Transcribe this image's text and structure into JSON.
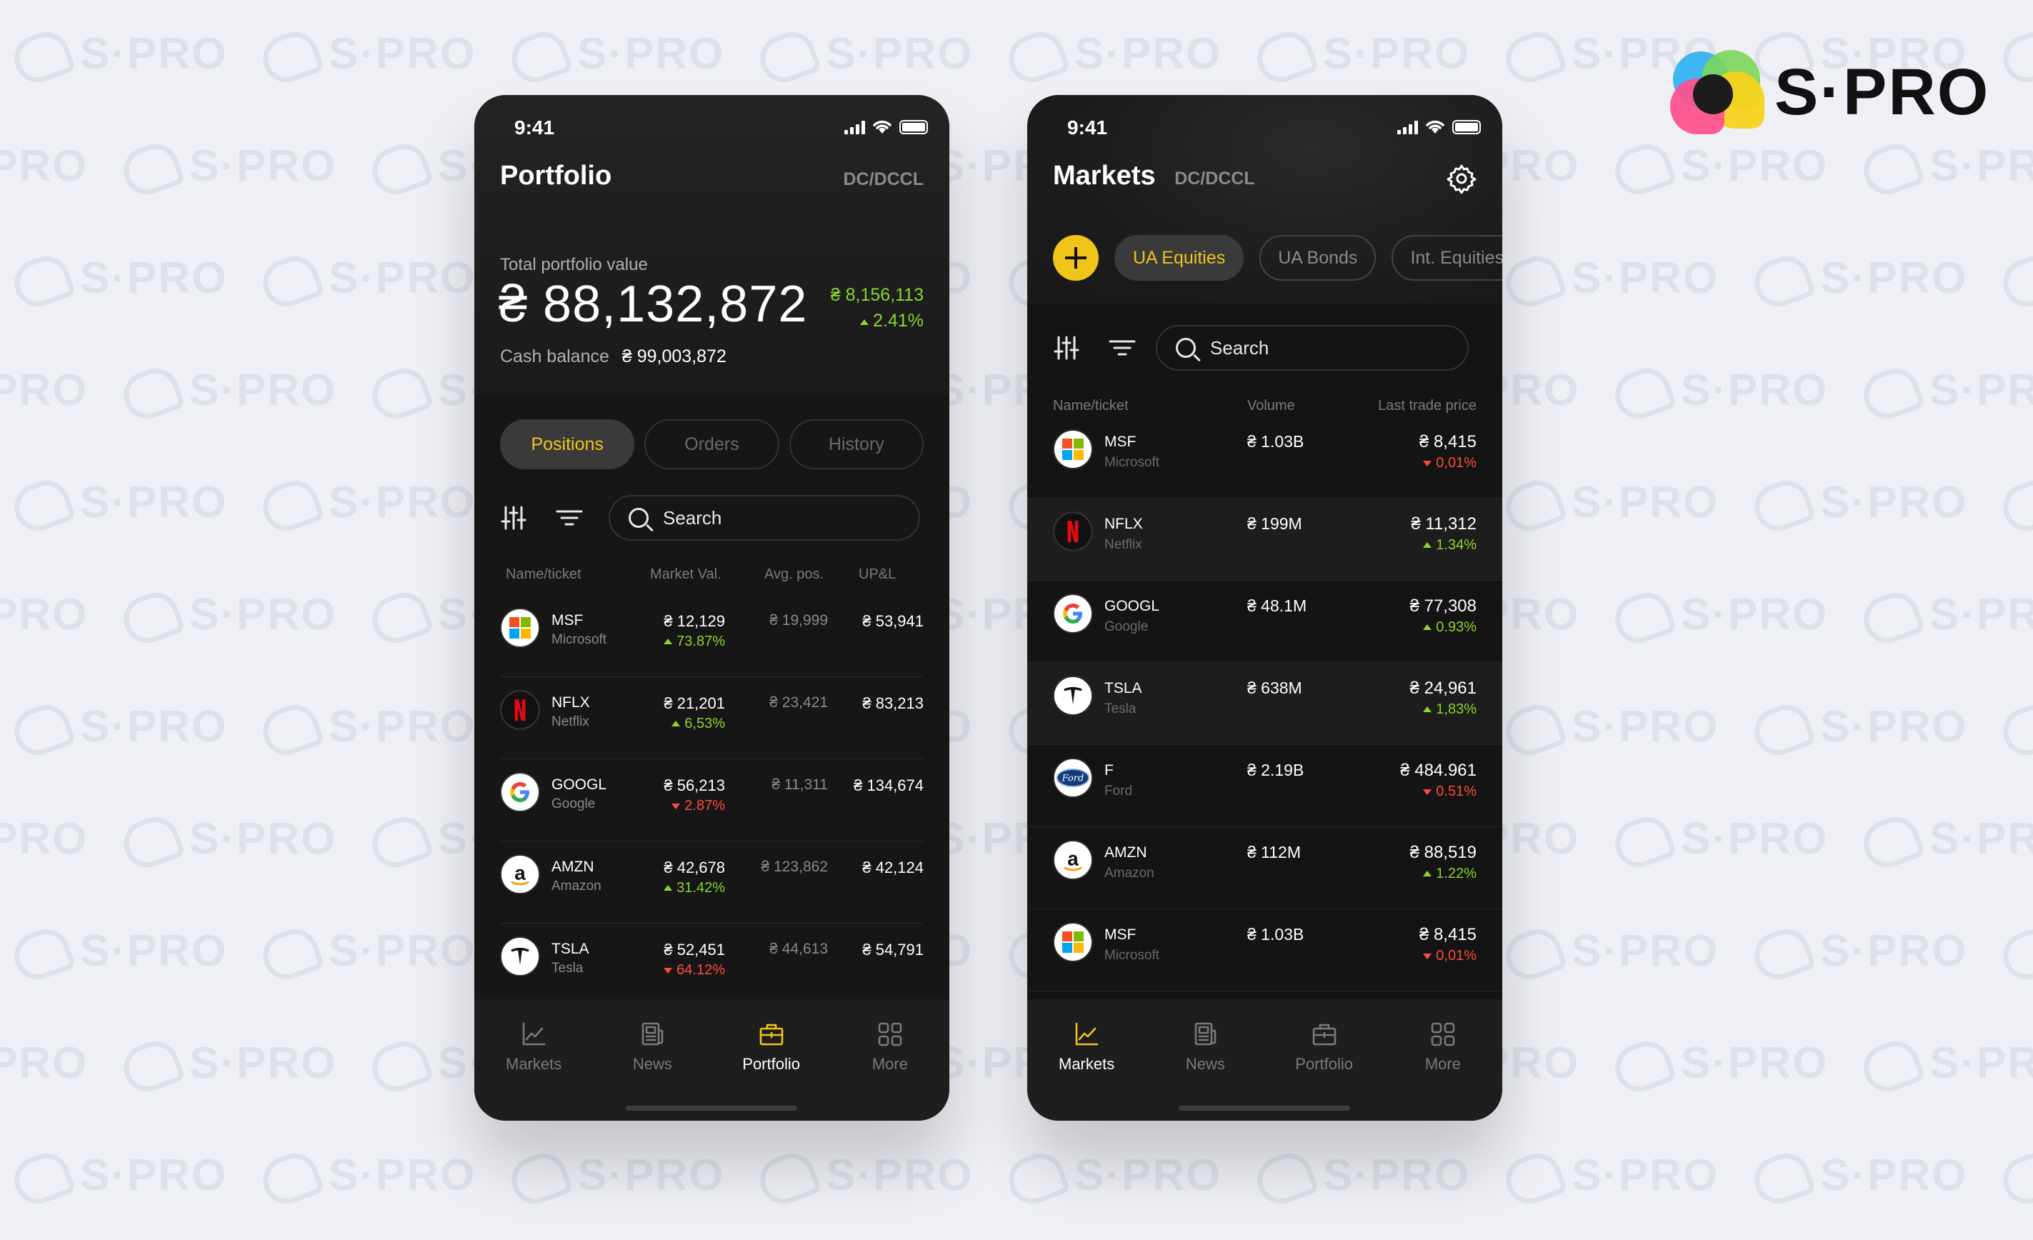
{
  "brand": {
    "name": "S·PRO",
    "watermark": "S·PRO"
  },
  "colors": {
    "accent": "#f0c419",
    "positive": "#8bd62a",
    "negative": "#ff4b3e",
    "background": "#161616"
  },
  "portfolio_screen": {
    "status_time": "9:41",
    "title": "Portfolio",
    "account_code": "DC/DCCL",
    "total_label": "Total portfolio value",
    "total_value": "₴ 88,132,872",
    "total_change_amount": "₴ 8,156,113",
    "total_change_pct": "2.41%",
    "cash_label": "Cash balance",
    "cash_value": "₴ 99,003,872",
    "tabs": [
      "Positions",
      "Orders",
      "History"
    ],
    "active_tab": "Positions",
    "search_placeholder": "Search",
    "columns": [
      "Name/ticket",
      "Market Val.",
      "Avg. pos.",
      "UP&L"
    ],
    "rows": [
      {
        "ticker": "MSF",
        "company": "Microsoft",
        "logo": "microsoft-icon",
        "market_val": "₴ 12,129",
        "change": "73.87%",
        "direction": "up",
        "avg_pos": "₴ 19,999",
        "upl": "₴ 53,941"
      },
      {
        "ticker": "NFLX",
        "company": "Netflix",
        "logo": "netflix-icon",
        "market_val": "₴ 21,201",
        "change": "6,53%",
        "direction": "up",
        "avg_pos": "₴ 23,421",
        "upl": "₴ 83,213"
      },
      {
        "ticker": "GOOGL",
        "company": "Google",
        "logo": "google-icon",
        "market_val": "₴ 56,213",
        "change": "2.87%",
        "direction": "down",
        "avg_pos": "₴ 11,311",
        "upl": "₴ 134,674"
      },
      {
        "ticker": "AMZN",
        "company": "Amazon",
        "logo": "amazon-icon",
        "market_val": "₴ 42,678",
        "change": "31.42%",
        "direction": "up",
        "avg_pos": "₴ 123,862",
        "upl": "₴ 42,124"
      },
      {
        "ticker": "TSLA",
        "company": "Tesla",
        "logo": "tesla-icon",
        "market_val": "₴ 52,451",
        "change": "64.12%",
        "direction": "down",
        "avg_pos": "₴ 44,613",
        "upl": "₴ 54,791"
      }
    ],
    "nav": [
      {
        "label": "Markets",
        "icon": "chart-icon"
      },
      {
        "label": "News",
        "icon": "news-icon"
      },
      {
        "label": "Portfolio",
        "icon": "briefcase-icon"
      },
      {
        "label": "More",
        "icon": "grid-icon"
      }
    ],
    "active_nav": "Portfolio"
  },
  "markets_screen": {
    "status_time": "9:41",
    "title": "Markets",
    "account_code": "DC/DCCL",
    "chips": [
      "UA Equities",
      "UA Bonds",
      "Int. Equities"
    ],
    "active_chip": "UA Equities",
    "search_placeholder": "Search",
    "columns": [
      "Name/ticket",
      "Volume",
      "Last trade price"
    ],
    "rows": [
      {
        "ticker": "MSF",
        "company": "Microsoft",
        "logo": "microsoft-icon",
        "volume": "₴ 1.03B",
        "price": "₴ 8,415",
        "change": "0,01%",
        "direction": "down"
      },
      {
        "ticker": "NFLX",
        "company": "Netflix",
        "logo": "netflix-icon",
        "volume": "₴ 199M",
        "price": "₴ 11,312",
        "change": "1.34%",
        "direction": "up"
      },
      {
        "ticker": "GOOGL",
        "company": "Google",
        "logo": "google-icon",
        "volume": "₴ 48.1M",
        "price": "₴ 77,308",
        "change": "0.93%",
        "direction": "up"
      },
      {
        "ticker": "TSLA",
        "company": "Tesla",
        "logo": "tesla-icon",
        "volume": "₴ 638M",
        "price": "₴ 24,961",
        "change": "1,83%",
        "direction": "up"
      },
      {
        "ticker": "F",
        "company": "Ford",
        "logo": "ford-icon",
        "volume": "₴ 2.19B",
        "price": "₴ 484.961",
        "change": "0.51%",
        "direction": "down"
      },
      {
        "ticker": "AMZN",
        "company": "Amazon",
        "logo": "amazon-icon",
        "volume": "₴ 112M",
        "price": "₴ 88,519",
        "change": "1.22%",
        "direction": "up"
      },
      {
        "ticker": "MSF",
        "company": "Microsoft",
        "logo": "microsoft-icon",
        "volume": "₴ 1.03B",
        "price": "₴ 8,415",
        "change": "0,01%",
        "direction": "down"
      }
    ],
    "nav": [
      {
        "label": "Markets",
        "icon": "chart-icon"
      },
      {
        "label": "News",
        "icon": "news-icon"
      },
      {
        "label": "Portfolio",
        "icon": "briefcase-icon"
      },
      {
        "label": "More",
        "icon": "grid-icon"
      }
    ],
    "active_nav": "Markets"
  }
}
